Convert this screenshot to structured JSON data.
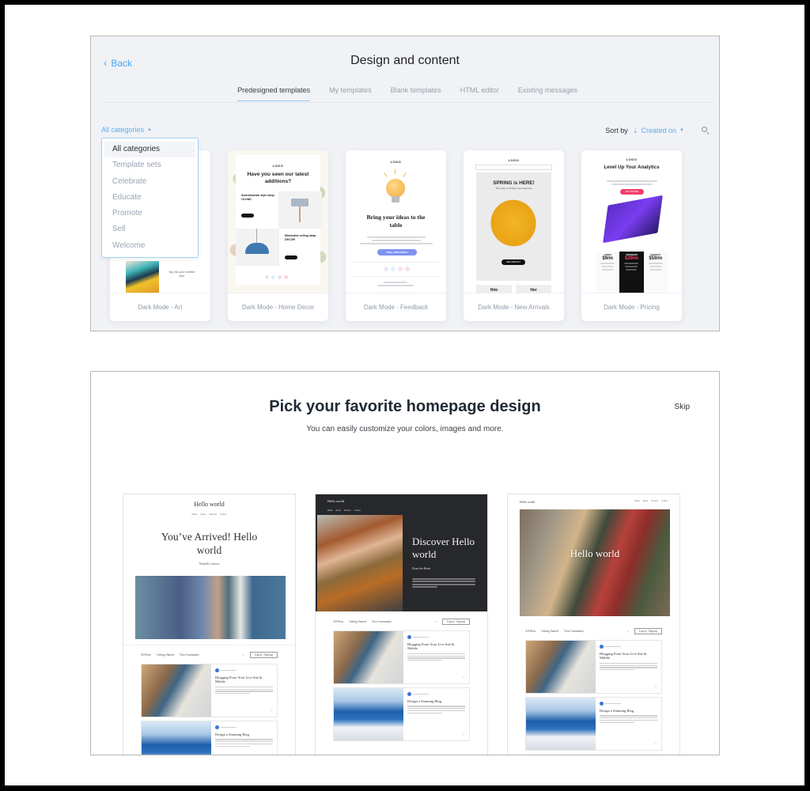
{
  "panel1": {
    "back_label": "Back",
    "title": "Design and content",
    "tabs": [
      {
        "label": "Predesigned templates",
        "active": true
      },
      {
        "label": "My templates",
        "active": false
      },
      {
        "label": "Blank templates",
        "active": false
      },
      {
        "label": "HTML editor",
        "active": false
      },
      {
        "label": "Existing messages",
        "active": false
      }
    ],
    "category_selector": "All categories",
    "sort_label": "Sort by",
    "sort_value": "Created on",
    "category_options": [
      "All categories",
      "Template sets",
      "Celebrate",
      "Educate",
      "Promote",
      "Sell",
      "Welcome"
    ],
    "selected_category": "All categories",
    "templates": [
      {
        "name": "Dark Mode - Art",
        "thumb_text": "Tap into your creative side"
      },
      {
        "name": "Dark Mode - Home Decor",
        "logo": "LOGO",
        "headline": "Have you seen our latest additions?",
        "item1": "Scandinavian style lamp OLUND",
        "item2": "Minimalist ceiling lamp DECOR",
        "cta": "SHOP NOW"
      },
      {
        "name": "Dark Mode - Feedback",
        "logo": "LOGO",
        "headline": "Bring your ideas to the table",
        "cta": "TAKE 1 MIN SURVEY"
      },
      {
        "name": "Dark Mode - New Arrivals",
        "logo": "LOGO",
        "headline": "SPRING is HERE!",
        "subline": "This season is all about new beginnings",
        "cta": "NEW ARRIVALS",
        "him": "Him",
        "her": "Her"
      },
      {
        "name": "Dark Mode - Pricing",
        "logo": "LOGO",
        "headline": "Level Up Your Analytics",
        "cta": "GET STARTED",
        "plans": [
          {
            "name": "JUNIOR",
            "price": "$9/m"
          },
          {
            "name": "ADVANCED",
            "price": "$29/m"
          },
          {
            "name": "SCIENTIST",
            "price": "$59/m"
          }
        ]
      }
    ]
  },
  "panel2": {
    "title": "Pick your favorite homepage design",
    "subtitle": "You can easily customize your colors, images and more.",
    "skip_label": "Skip",
    "designs": [
      {
        "site_title": "Hello world",
        "nav": [
          "Home",
          "About",
          "Services",
          "Contact"
        ],
        "hero": "You’ve Arrived! Hello world",
        "tagline": "Naturally Curious"
      },
      {
        "site_title": "Hello world",
        "nav": [
          "Home",
          "About",
          "Services",
          "Contact"
        ],
        "hero": "Discover Hello world",
        "tagline": "From the Heart"
      },
      {
        "site_title": "Hello world",
        "nav": [
          "Home",
          "About",
          "Services",
          "Contact"
        ],
        "hero": "Hello world"
      }
    ],
    "feed": {
      "tabs": [
        "All Posts",
        "Getting Started",
        "Your Community"
      ],
      "login": "Log in / Sign up",
      "posts": [
        {
          "title": "Blogging From Your Live Site & Mobile"
        },
        {
          "title": "Design a Stunning Blog"
        }
      ]
    }
  }
}
